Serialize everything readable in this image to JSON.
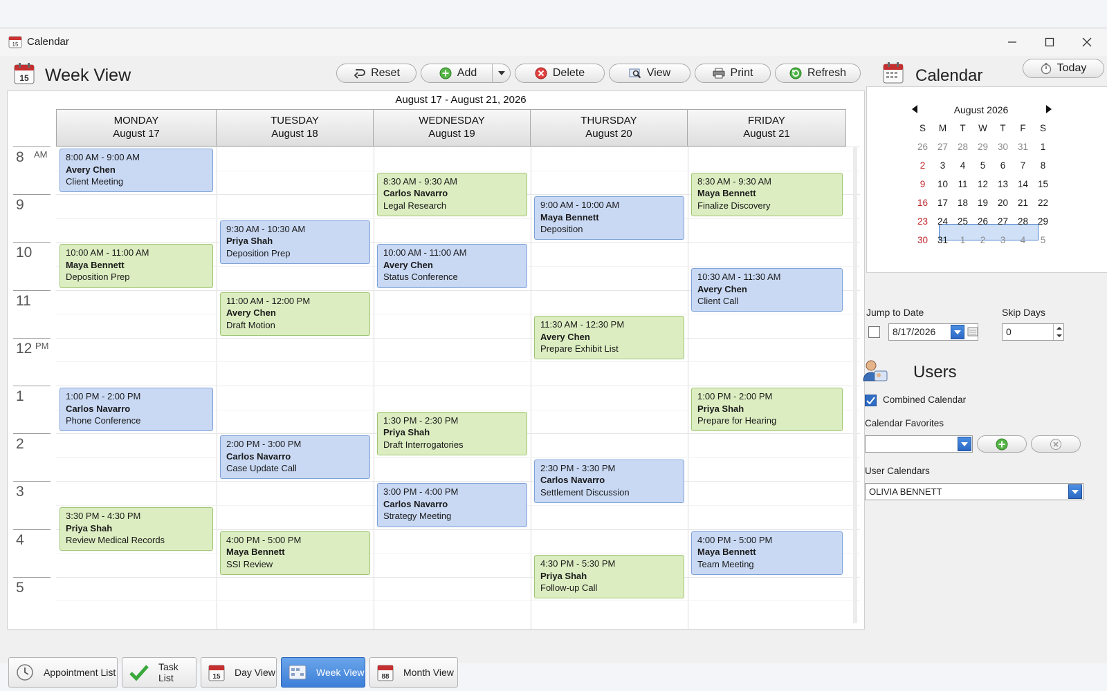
{
  "window": {
    "title": "Calendar"
  },
  "toolbar": {
    "view_title": "Week View",
    "buttons": {
      "reset": "Reset",
      "add": "Add",
      "delete": "Delete",
      "view": "View",
      "print": "Print",
      "refresh": "Refresh"
    }
  },
  "week": {
    "range": "August 17 - August 21, 2026",
    "days": [
      {
        "name": "MONDAY",
        "date": "August 17"
      },
      {
        "name": "TUESDAY",
        "date": "August 18"
      },
      {
        "name": "WEDNESDAY",
        "date": "August 19"
      },
      {
        "name": "THURSDAY",
        "date": "August 20"
      },
      {
        "name": "FRIDAY",
        "date": "August 21"
      }
    ],
    "hours": [
      "8",
      "9",
      "10",
      "11",
      "12",
      "1",
      "2",
      "3",
      "4",
      "5"
    ],
    "am": "AM",
    "pm": "PM"
  },
  "appointments": [
    {
      "day": 0,
      "start": 8.0,
      "end": 9.0,
      "color": "blue",
      "time": "8:00 AM - 9:00 AM",
      "who": "Avery Chen",
      "what": "Client Meeting"
    },
    {
      "day": 0,
      "start": 10.0,
      "end": 11.0,
      "color": "green",
      "time": "10:00 AM - 11:00 AM",
      "who": "Maya Bennett",
      "what": "Deposition Prep"
    },
    {
      "day": 0,
      "start": 13.0,
      "end": 14.0,
      "color": "blue",
      "time": "1:00 PM - 2:00 PM",
      "who": "Carlos Navarro",
      "what": "Phone Conference"
    },
    {
      "day": 0,
      "start": 15.5,
      "end": 16.5,
      "color": "green",
      "time": "3:30 PM - 4:30 PM",
      "who": "Priya Shah",
      "what": "Review Medical Records"
    },
    {
      "day": 1,
      "start": 9.5,
      "end": 10.5,
      "color": "blue",
      "time": "9:30 AM - 10:30 AM",
      "who": "Priya Shah",
      "what": "Deposition Prep"
    },
    {
      "day": 1,
      "start": 11.0,
      "end": 12.0,
      "color": "green",
      "time": "11:00 AM - 12:00 PM",
      "who": "Avery Chen",
      "what": "Draft Motion"
    },
    {
      "day": 1,
      "start": 14.0,
      "end": 15.0,
      "color": "blue",
      "time": "2:00 PM - 3:00 PM",
      "who": "Carlos Navarro",
      "what": "Case Update Call"
    },
    {
      "day": 1,
      "start": 16.0,
      "end": 17.0,
      "color": "green",
      "time": "4:00 PM - 5:00 PM",
      "who": "Maya Bennett",
      "what": "SSI Review"
    },
    {
      "day": 2,
      "start": 8.5,
      "end": 9.5,
      "color": "green",
      "time": "8:30 AM - 9:30 AM",
      "who": "Carlos Navarro",
      "what": "Legal Research"
    },
    {
      "day": 2,
      "start": 10.0,
      "end": 11.0,
      "color": "blue",
      "time": "10:00 AM - 11:00 AM",
      "who": "Avery Chen",
      "what": "Status Conference"
    },
    {
      "day": 2,
      "start": 13.5,
      "end": 14.5,
      "color": "green",
      "time": "1:30 PM - 2:30 PM",
      "who": "Priya Shah",
      "what": "Draft Interrogatories"
    },
    {
      "day": 2,
      "start": 15.0,
      "end": 16.0,
      "color": "blue",
      "time": "3:00 PM - 4:00 PM",
      "who": "Carlos Navarro",
      "what": "Strategy Meeting"
    },
    {
      "day": 3,
      "start": 9.0,
      "end": 10.0,
      "color": "blue",
      "time": "9:00 AM - 10:00 AM",
      "who": "Maya Bennett",
      "what": "Deposition"
    },
    {
      "day": 3,
      "start": 11.5,
      "end": 12.5,
      "color": "green",
      "time": "11:30 AM - 12:30 PM",
      "who": "Avery Chen",
      "what": "Prepare Exhibit List"
    },
    {
      "day": 3,
      "start": 14.5,
      "end": 15.5,
      "color": "blue",
      "time": "2:30 PM - 3:30 PM",
      "who": "Carlos Navarro",
      "what": "Settlement Discussion"
    },
    {
      "day": 3,
      "start": 16.5,
      "end": 17.5,
      "color": "green",
      "time": "4:30 PM - 5:30 PM",
      "who": "Priya Shah",
      "what": "Follow-up Call"
    },
    {
      "day": 4,
      "start": 8.5,
      "end": 9.5,
      "color": "green",
      "time": "8:30 AM - 9:30 AM",
      "who": "Maya Bennett",
      "what": "Finalize Discovery"
    },
    {
      "day": 4,
      "start": 10.5,
      "end": 11.5,
      "color": "blue",
      "time": "10:30 AM - 11:30 AM",
      "who": "Avery Chen",
      "what": "Client Call"
    },
    {
      "day": 4,
      "start": 13.0,
      "end": 14.0,
      "color": "green",
      "time": "1:00 PM - 2:00 PM",
      "who": "Priya Shah",
      "what": "Prepare for Hearing"
    },
    {
      "day": 4,
      "start": 16.0,
      "end": 17.0,
      "color": "blue",
      "time": "4:00 PM - 5:00 PM",
      "who": "Maya Bennett",
      "what": "Team Meeting"
    }
  ],
  "tabs": [
    {
      "label": "Appointment List",
      "icon": "clock-icon",
      "active": false
    },
    {
      "label": "Task List",
      "icon": "checkmark-icon",
      "active": false
    },
    {
      "label": "Day View",
      "icon": "day-calendar-icon",
      "active": false
    },
    {
      "label": "Week View",
      "icon": "week-calendar-icon",
      "active": true
    },
    {
      "label": "Month View",
      "icon": "month-calendar-icon",
      "active": false
    }
  ],
  "sidebar": {
    "title": "Calendar",
    "today_label": "Today",
    "mini_calendar": {
      "month_label": "August 2026",
      "dow": [
        "S",
        "M",
        "T",
        "W",
        "T",
        "F",
        "S"
      ],
      "weeks": [
        [
          "26",
          "27",
          "28",
          "29",
          "30",
          "31",
          "1"
        ],
        [
          "2",
          "3",
          "4",
          "5",
          "6",
          "7",
          "8"
        ],
        [
          "9",
          "10",
          "11",
          "12",
          "13",
          "14",
          "15"
        ],
        [
          "16",
          "17",
          "18",
          "19",
          "20",
          "21",
          "22"
        ],
        [
          "23",
          "24",
          "25",
          "26",
          "27",
          "28",
          "29"
        ],
        [
          "30",
          "31",
          "1",
          "2",
          "3",
          "4",
          "5"
        ]
      ],
      "selected": [
        "17",
        "18",
        "19",
        "20",
        "21"
      ]
    },
    "jump_to_date": {
      "label": "Jump to Date",
      "checked": false,
      "value": "8/17/2026"
    },
    "skip_days": {
      "label": "Skip Days",
      "value": "0"
    },
    "users": {
      "title": "Users",
      "combined_label": "Combined Calendar",
      "combined_checked": true,
      "favorites_label": "Calendar Favorites",
      "favorites_value": "",
      "user_calendars_label": "User Calendars",
      "user_calendars_value": "OLIVIA BENNETT"
    }
  },
  "colors": {
    "blue_event": "#c9d9f4",
    "green_event": "#dcedc1",
    "active_tab": "#3c7fd8",
    "sunday_red": "#c0262b"
  }
}
